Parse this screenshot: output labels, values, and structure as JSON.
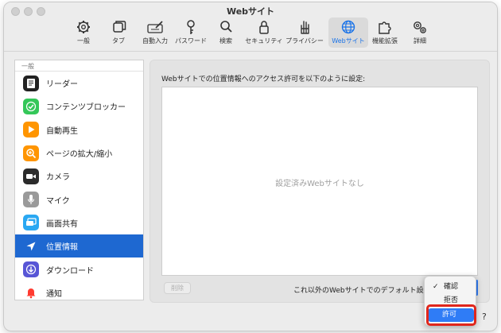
{
  "window": {
    "title": "Webサイト"
  },
  "toolbar": {
    "items": [
      {
        "label": "一般",
        "icon": "gear-icon"
      },
      {
        "label": "タブ",
        "icon": "tabs-icon"
      },
      {
        "label": "自動入力",
        "icon": "pencil-icon"
      },
      {
        "label": "パスワード",
        "icon": "key-icon"
      },
      {
        "label": "検索",
        "icon": "search-icon"
      },
      {
        "label": "セキュリティ",
        "icon": "lock-icon"
      },
      {
        "label": "プライバシー",
        "icon": "hand-icon"
      },
      {
        "label": "Webサイト",
        "icon": "globe-icon",
        "active": true
      },
      {
        "label": "機能拡張",
        "icon": "puzzle-icon"
      },
      {
        "label": "詳細",
        "icon": "gears-icon"
      }
    ]
  },
  "sidebar": {
    "header": "一般",
    "items": [
      {
        "label": "リーダー",
        "icon": "reader-icon",
        "color": "#222222"
      },
      {
        "label": "コンテンツブロッカー",
        "icon": "checkmark-icon",
        "color": "#34c759"
      },
      {
        "label": "自動再生",
        "icon": "play-icon",
        "color": "#ff9500"
      },
      {
        "label": "ページの拡大/縮小",
        "icon": "zoom-icon",
        "color": "#ff9500"
      },
      {
        "label": "カメラ",
        "icon": "camera-icon",
        "color": "#2b2b2b"
      },
      {
        "label": "マイク",
        "icon": "microphone-icon",
        "color": "#9a9a9a"
      },
      {
        "label": "画面共有",
        "icon": "screen-share-icon",
        "color": "#2aa8f2"
      },
      {
        "label": "位置情報",
        "icon": "location-icon",
        "color": "#1e68d1",
        "selected": true
      },
      {
        "label": "ダウンロード",
        "icon": "download-icon",
        "color": "#5856d6"
      },
      {
        "label": "通知",
        "icon": "bell-icon",
        "color": "#ff3b30"
      }
    ]
  },
  "main": {
    "description": "Webサイトでの位置情報へのアクセス許可を以下のように設定:",
    "empty_message": "設定済みWebサイトなし",
    "delete_label": "削除",
    "default_label": "これ以外のWebサイトでのデフォルト設定:"
  },
  "popup": {
    "options": [
      {
        "label": "確認",
        "checked": true
      },
      {
        "label": "拒否",
        "checked": false
      },
      {
        "label": "許可",
        "checked": false,
        "highlighted": true
      }
    ]
  },
  "help": {
    "label": "?"
  }
}
